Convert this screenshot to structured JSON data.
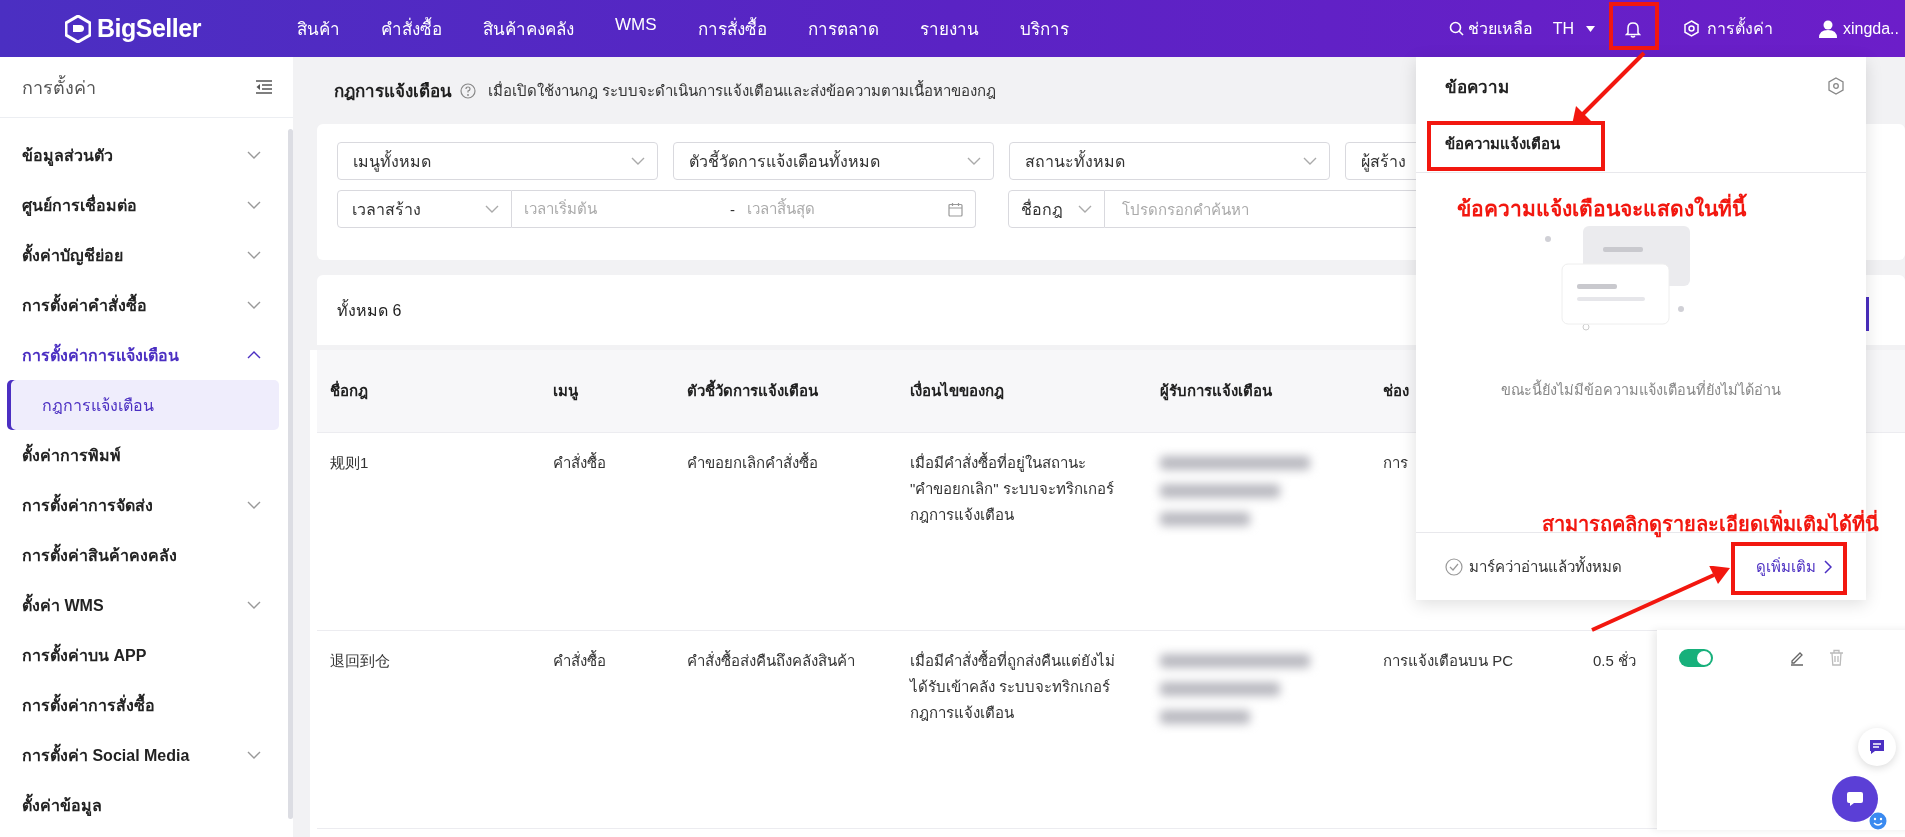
{
  "top_nav": {
    "logo": "BigSeller",
    "menu": [
      "สินค้า",
      "คำสั่งซื้อ",
      "สินค้าคงคลัง",
      "WMS",
      "การสั่งซื้อ",
      "การตลาด",
      "รายงาน",
      "บริการ"
    ],
    "help": "ช่วยเหลือ",
    "language": "TH",
    "settings": "การตั้งค่า",
    "user": "xingda.."
  },
  "sidebar": {
    "title": "การตั้งค่า",
    "items": [
      {
        "label": "ข้อมูลส่วนตัว",
        "expandable": true,
        "expanded": false
      },
      {
        "label": "ศูนย์การเชื่อมต่อ",
        "expandable": true,
        "expanded": false
      },
      {
        "label": "ตั้งค่าบัญชีย่อย",
        "expandable": true,
        "expanded": false
      },
      {
        "label": "การตั้งค่าคำสั่งซื้อ",
        "expandable": true,
        "expanded": false
      },
      {
        "label": "การตั้งค่าการแจ้งเตือน",
        "expandable": true,
        "expanded": true,
        "children": [
          {
            "label": "กฎการแจ้งเตือน",
            "selected": true
          }
        ]
      },
      {
        "label": "ตั้งค่าการพิมพ์",
        "expandable": false,
        "expanded": false
      },
      {
        "label": "การตั้งค่าการจัดส่ง",
        "expandable": true,
        "expanded": false
      },
      {
        "label": "การตั้งค่าสินค้าคงคลัง",
        "expandable": false,
        "expanded": false
      },
      {
        "label": "ตั้งค่า WMS",
        "expandable": true,
        "expanded": false
      },
      {
        "label": "การตั้งค่าบน APP",
        "expandable": false,
        "expanded": false
      },
      {
        "label": "การตั้งค่าการสั่งซื้อ",
        "expandable": false,
        "expanded": false
      },
      {
        "label": "การตั้งค่า Social Media",
        "expandable": true,
        "expanded": false
      },
      {
        "label": "ตั้งค่าข้อมูล",
        "expandable": false,
        "expanded": false
      }
    ]
  },
  "page": {
    "title": "กฎการแจ้งเตือน",
    "description": "เมื่อเปิดใช้งานกฎ ระบบจะดำเนินการแจ้งเตือนและส่งข้อความตามเนื้อหาของกฎ"
  },
  "filters": {
    "dropdowns": [
      "เมนูทั้งหมด",
      "ตัวชี้วัดการแจ้งเตือนทั้งหมด",
      "สถานะทั้งหมด",
      "ผู้สร้าง"
    ],
    "time_type": "เวลาสร้าง",
    "start_placeholder": "เวลาเริ่มต้น",
    "separator": "-",
    "end_placeholder": "เวลาสิ้นสุด",
    "search_type": "ชื่อกฎ",
    "search_placeholder": "โปรดกรอกคำค้นหา"
  },
  "total": "ทั้งหมด 6",
  "table": {
    "columns": [
      "ชื่อกฎ",
      "เมนู",
      "ตัวชี้วัดการแจ้งเตือน",
      "เงื่อนไขของกฎ",
      "ผู้รับการแจ้งเตือน",
      "ช่อง"
    ],
    "rows": [
      {
        "name": "规则1",
        "menu": "คำสั่งซื้อ",
        "metric": "คำขอยกเลิกคำสั่งซื้อ",
        "condition": "เมื่อมีคำสั่งซื้อที่อยู่ในสถานะ \"คำขอยกเลิก\" ระบบจะทริกเกอร์กฎการแจ้งเตือน",
        "channel": "การ"
      },
      {
        "name": "退回到仓",
        "menu": "คำสั่งซื้อ",
        "metric": "คำสั่งซื้อส่งคืนถึงคลังสินค้า",
        "condition": "เมื่อมีคำสั่งซื้อที่ถูกส่งคืนแต่ยังไม่ได้รับเข้าคลัง ระบบจะทริกเกอร์กฎการแจ้งเตือน",
        "channel": "การแจ้งเตือนบน PC",
        "interval": "0.5 ชั่ว",
        "enabled": true
      }
    ]
  },
  "notification_popup": {
    "title": "ข้อความ",
    "tabs": [
      {
        "label": "ข้อความแจ้งเตือน",
        "selected": true
      }
    ],
    "empty_text": "ขณะนี้ยังไม่มีข้อความแจ้งเตือนที่ยังไม่ได้อ่าน",
    "mark_all_read": "มาร์คว่าอ่านแล้วทั้งหมด",
    "more_link": "ดูเพิ่มเติม"
  },
  "annotations": [
    {
      "text": "ข้อความแจ้งเตือนจะแสดงในที่นี้"
    },
    {
      "text": "สามารถคลิกดูรายละเอียดเพิ่มเติมได้ที่นี่"
    }
  ]
}
